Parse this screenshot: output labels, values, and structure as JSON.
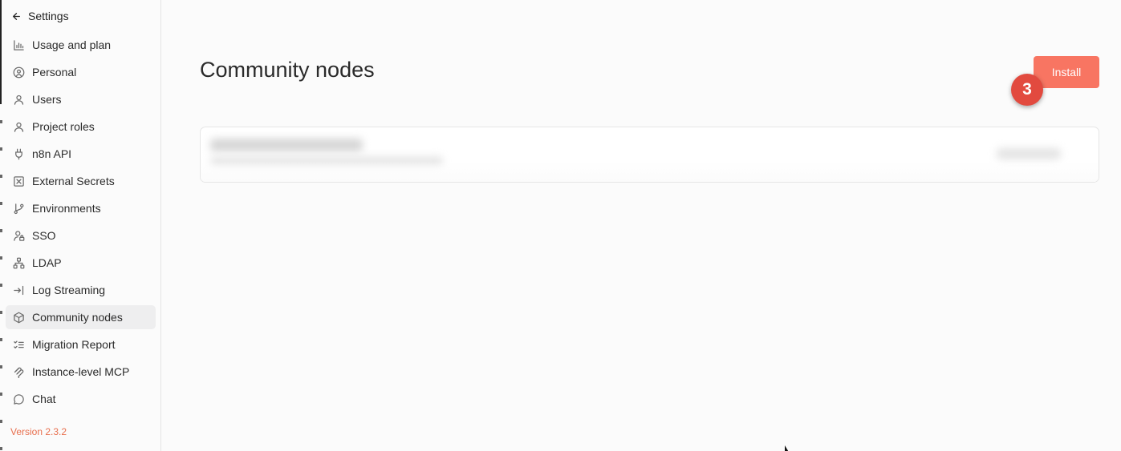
{
  "sidebar": {
    "back_label": "Settings",
    "items": [
      {
        "label": "Usage and plan",
        "icon": "chart-icon",
        "active": false
      },
      {
        "label": "Personal",
        "icon": "user-circle-icon",
        "active": false
      },
      {
        "label": "Users",
        "icon": "user-icon",
        "active": false
      },
      {
        "label": "Project roles",
        "icon": "user-icon",
        "active": false
      },
      {
        "label": "n8n API",
        "icon": "plug-icon",
        "active": false
      },
      {
        "label": "External Secrets",
        "icon": "square-x-icon",
        "active": false
      },
      {
        "label": "Environments",
        "icon": "git-branch-icon",
        "active": false
      },
      {
        "label": "SSO",
        "icon": "user-lock-icon",
        "active": false
      },
      {
        "label": "LDAP",
        "icon": "network-icon",
        "active": false
      },
      {
        "label": "Log Streaming",
        "icon": "log-in-icon",
        "active": false
      },
      {
        "label": "Community nodes",
        "icon": "box-icon",
        "active": true
      },
      {
        "label": "Migration Report",
        "icon": "list-checks-icon",
        "active": false
      },
      {
        "label": "Instance-level MCP",
        "icon": "mcp-icon",
        "active": false
      },
      {
        "label": "Chat",
        "icon": "message-circle-icon",
        "active": false
      }
    ],
    "version": "Version 2.3.2"
  },
  "main": {
    "title": "Community nodes",
    "install_label": "Install",
    "step_badge": "3"
  },
  "colors": {
    "accent": "#f87562",
    "badge": "#e24a3f",
    "version_text": "#e8704f"
  }
}
